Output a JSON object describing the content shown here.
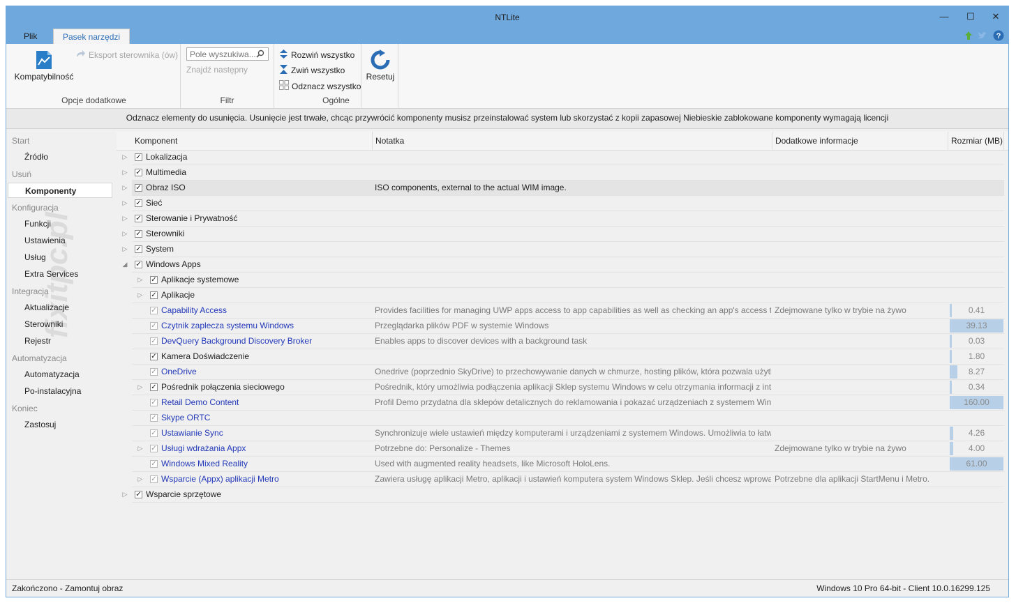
{
  "window": {
    "title": "NTLite"
  },
  "tabs": [
    {
      "label": "Plik"
    },
    {
      "label": "Pasek narzędzi"
    }
  ],
  "ribbon": {
    "kompatybilnosc": "Kompatybilność",
    "eksport": "Eksport sterownika (ów)",
    "group_opcje": "Opcje dodatkowe",
    "search_placeholder": "Pole wyszukiwa...",
    "znajdz": "Znajdź następny",
    "group_filtr": "Filtr",
    "rozwin": "Rozwiń wszystko",
    "zwin": "Zwiń wszystko",
    "odznacz": "Odznacz wszystko",
    "resetuj": "Resetuj",
    "group_ogolne": "Ogólne"
  },
  "banner": "Odznacz elementy do usunięcia. Usunięcie jest trwałe, chcąc przywrócić komponenty musisz przeinstalować system lub skorzystać z kopii zapasowej Niebieskie zablokowane komponenty wymagają licencji",
  "nav": {
    "s_start": "Start",
    "i_zrodlo": "Źródło",
    "s_usun": "Usuń",
    "i_komponenty": "Komponenty",
    "s_konfig": "Konfiguracja",
    "i_funkcji": "Funkcji",
    "i_ustawienia": "Ustawienia",
    "i_uslug": "Usług",
    "i_extra": "Extra Services",
    "s_integracja": "Integracja",
    "i_aktualizacje": "Aktualizacje",
    "i_sterowniki": "Sterowniki",
    "i_rejestr": "Rejestr",
    "s_automatyzacja": "Automatyzacja",
    "i_automatyzacja": "Automatyzacja",
    "i_poinst": "Po-instalacyjna",
    "s_koniec": "Koniec",
    "i_zastosuj": "Zastosuj"
  },
  "watermark": "fixitpc.pl",
  "columns": {
    "komponent": "Komponent",
    "notatka": "Notatka",
    "dodatkowe": "Dodatkowe informacje",
    "rozmiar": "Rozmiar (MB)"
  },
  "rows": [
    {
      "name": "Lokalizacja",
      "note": "",
      "info": "",
      "size": "",
      "size_fraction": 0
    },
    {
      "name": "Multimedia",
      "note": "",
      "info": "",
      "size": "",
      "size_fraction": 0
    },
    {
      "name": "Obraz ISO",
      "note": "ISO components, external to the actual WIM image.",
      "info": "",
      "size": "",
      "size_fraction": 0
    },
    {
      "name": "Sieć",
      "note": "",
      "info": "",
      "size": "",
      "size_fraction": 0
    },
    {
      "name": "Sterowanie i Prywatność",
      "note": "",
      "info": "",
      "size": "",
      "size_fraction": 0
    },
    {
      "name": "Sterowniki",
      "note": "",
      "info": "",
      "size": "",
      "size_fraction": 0
    },
    {
      "name": "System",
      "note": "",
      "info": "",
      "size": "",
      "size_fraction": 0
    },
    {
      "name": "Windows Apps",
      "note": "",
      "info": "",
      "size": "",
      "size_fraction": 0
    },
    {
      "name": "Aplikacje systemowe",
      "note": "",
      "info": "",
      "size": "",
      "size_fraction": 0
    },
    {
      "name": "Aplikacje",
      "note": "",
      "info": "",
      "size": "",
      "size_fraction": 0
    },
    {
      "name": "Capability Access",
      "note": "Provides facilities for managing UWP apps access to app capabilities as well as checking an app's access to specific ...",
      "info": "Zdejmowane tylko w trybie na żywo",
      "size": "0.41",
      "size_fraction": 0.02
    },
    {
      "name": "Czytnik zaplecza systemu Windows",
      "note": "Przeglądarka plików PDF w systemie Windows",
      "info": "",
      "size": "39.13",
      "size_fraction": 1.0
    },
    {
      "name": "DevQuery Background Discovery Broker",
      "note": "Enables apps to discover devices with a background task",
      "info": "",
      "size": "0.03",
      "size_fraction": 0.01
    },
    {
      "name": "Kamera Doświadczenie",
      "note": "",
      "info": "",
      "size": "1.80",
      "size_fraction": 0.02
    },
    {
      "name": "OneDrive",
      "note": "Onedrive (poprzednio SkyDrive) to przechowywanie danych w chmurze, hosting plików, która pozwala użytkownikom ...",
      "info": "",
      "size": "8.27",
      "size_fraction": 0.14
    },
    {
      "name": "Pośrednik połączenia sieciowego",
      "note": "Pośrednik, który umożliwia podłączenia aplikacji Sklep systemu Windows w celu otrzymania informacji z internetu",
      "info": "",
      "size": "0.34",
      "size_fraction": 0.02
    },
    {
      "name": "Retail Demo Content",
      "note": "Profil Demo przydatna dla sklepów detalicznych do reklamowania i pokazać urządzeniach z systemem Windows.",
      "info": "",
      "size": "160.00",
      "size_fraction": 1.0
    },
    {
      "name": "Skype ORTC",
      "note": "",
      "info": "",
      "size": "",
      "size_fraction": 0
    },
    {
      "name": "Ustawianie Sync",
      "note": "Synchronizuje wiele ustawień między komputerami i urządzeniami z systemem Windows. Umożliwia to łatwiejsze przemi...",
      "info": "",
      "size": "4.26",
      "size_fraction": 0.07
    },
    {
      "name": "Usługi wdrażania Appx",
      "note": "Potrzebne do: Personalize - Themes",
      "info": "Zdejmowane tylko w trybie na żywo",
      "size": "4.00",
      "size_fraction": 0.07
    },
    {
      "name": "Windows Mixed Reality",
      "note": "Used with augmented reality headsets, like Microsoft HoloLens.",
      "info": "",
      "size": "61.00",
      "size_fraction": 1.0
    },
    {
      "name": "Wsparcie (Appx) aplikacji Metro",
      "note": "Zawiera usługę aplikacji Metro, aplikacji i ustawień komputera system Windows Sklep. Jeśli chcesz wprowadzić klucz ...",
      "info": "Potrzebne dla aplikacji StartMenu i Metro.",
      "size": "",
      "size_fraction": 0
    },
    {
      "name": "Wsparcie sprzętowe",
      "note": "",
      "info": "",
      "size": "",
      "size_fraction": 0
    }
  ],
  "status": {
    "left": "Zakończono - Zamontuj obraz",
    "right": "Windows 10 Pro 64-bit - Client 10.0.16299.125"
  },
  "colors": {
    "accent": "#6fa8dc",
    "blocked_text": "#2238b8",
    "size_bar": "#b7d0e8"
  }
}
